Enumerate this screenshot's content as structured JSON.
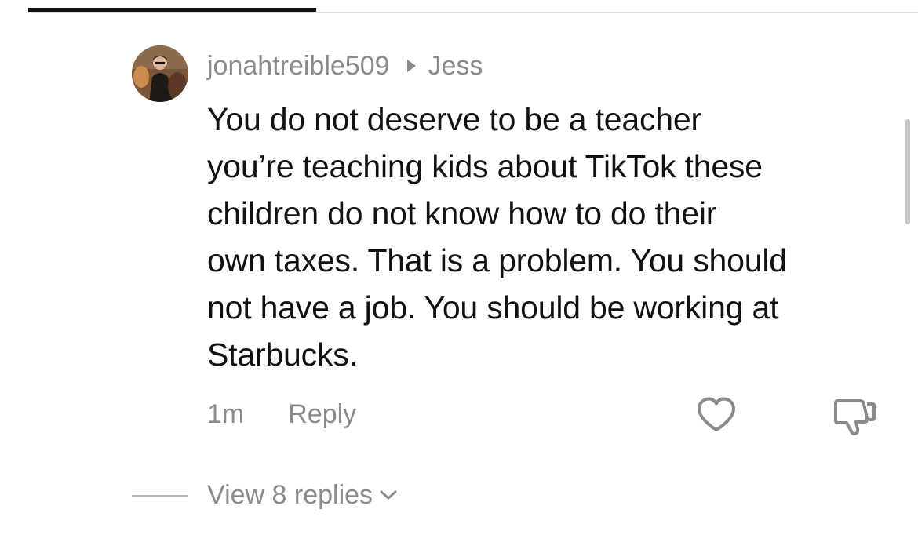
{
  "comment": {
    "username": "jonahtreible509",
    "reply_to": "Jess",
    "text": "You do not deserve to be a teacher\nyou’re teaching kids about TikTok these\nchildren do not know how to do their\nown taxes. That is a problem. You should\nnot have a job. You should be working at\nStarbucks.",
    "time": "1m",
    "reply_label": "Reply",
    "view_replies_label": "View 8 replies"
  },
  "icons": {
    "avatar": "avatar",
    "reply_arrow": "play-triangle-icon",
    "like": "heart-icon",
    "dislike": "thumbs-down-icon",
    "expand": "chevron-down-icon"
  },
  "colors": {
    "text_primary": "#111111",
    "text_secondary": "#8a8a8a",
    "divider": "#dcdcdc",
    "tab_indicator": "#111111"
  }
}
